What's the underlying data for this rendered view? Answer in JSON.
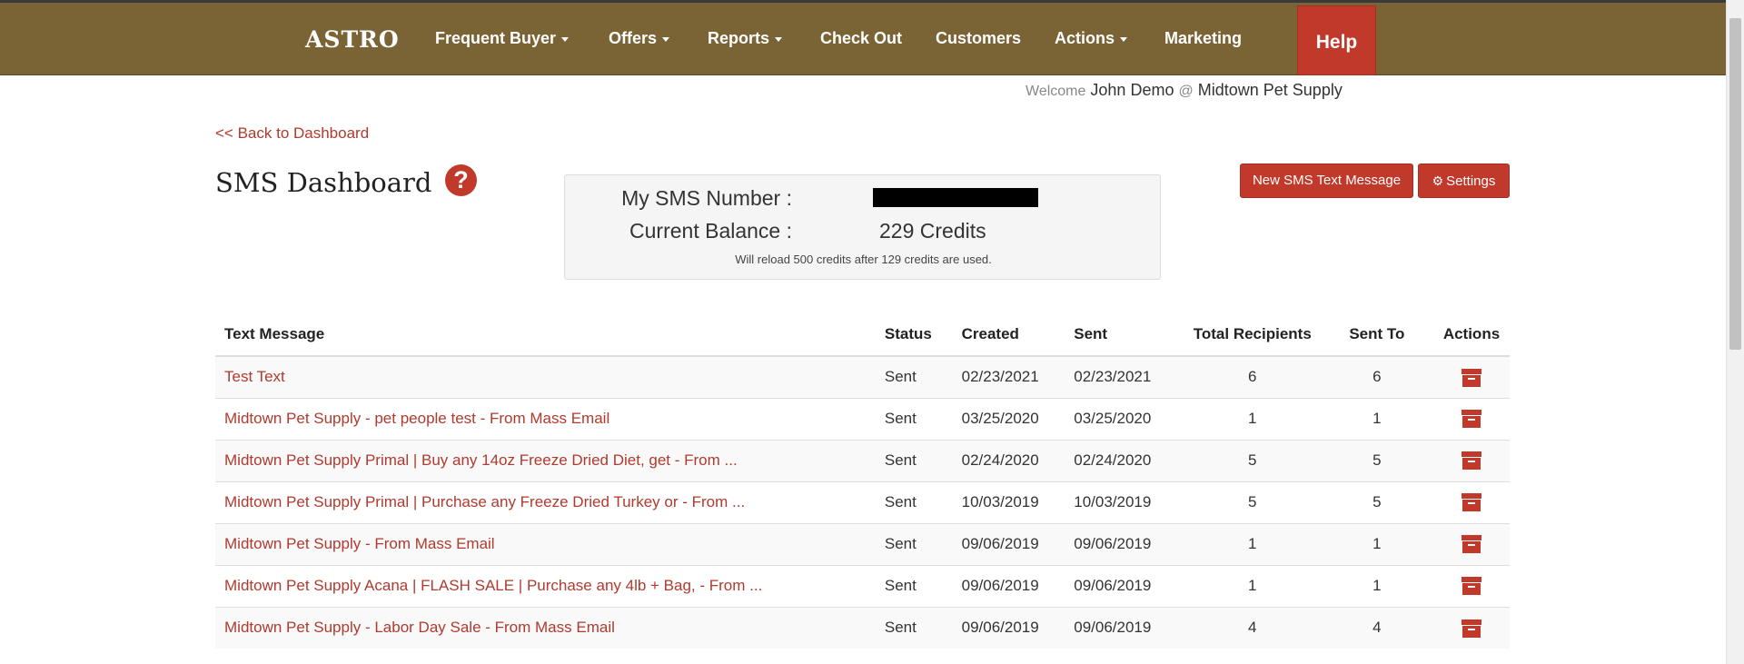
{
  "nav": {
    "brand": "ASTRO",
    "items": [
      {
        "label": "Frequent Buyer",
        "dropdown": true
      },
      {
        "label": "Offers",
        "dropdown": true
      },
      {
        "label": "Reports",
        "dropdown": true
      },
      {
        "label": "Check Out",
        "dropdown": false
      },
      {
        "label": "Customers",
        "dropdown": false
      },
      {
        "label": "Actions",
        "dropdown": true
      },
      {
        "label": "Marketing",
        "dropdown": false
      }
    ],
    "help": "Help",
    "colors": {
      "bar": "#7a6334",
      "accent": "#c0392b"
    }
  },
  "welcome": {
    "prefix": "Welcome",
    "user": "John Demo",
    "at": "@",
    "store": "Midtown Pet Supply"
  },
  "back_link": "<< Back to Dashboard",
  "page_title": "SMS Dashboard",
  "help_icon": "question-circle-icon",
  "balance": {
    "number_label": "My SMS Number :",
    "balance_label": "Current Balance :",
    "balance_value": "229 Credits",
    "note": "Will reload 500 credits after 129 credits are used."
  },
  "buttons": {
    "new_sms": "New SMS Text Message",
    "settings": "Settings",
    "settings_icon": "gear-icon"
  },
  "table": {
    "headers": [
      "Text Message",
      "Status",
      "Created",
      "Sent",
      "Total Recipients",
      "Sent To",
      "Actions"
    ],
    "rows": [
      {
        "message": "Test Text",
        "status": "Sent",
        "created": "02/23/2021",
        "sent": "02/23/2021",
        "total": "6",
        "sent_to": "6"
      },
      {
        "message": "Midtown Pet Supply - pet people test - From Mass Email",
        "status": "Sent",
        "created": "03/25/2020",
        "sent": "03/25/2020",
        "total": "1",
        "sent_to": "1"
      },
      {
        "message": "Midtown Pet Supply Primal | Buy any 14oz Freeze Dried Diet, get - From ...",
        "status": "Sent",
        "created": "02/24/2020",
        "sent": "02/24/2020",
        "total": "5",
        "sent_to": "5"
      },
      {
        "message": "Midtown Pet Supply Primal | Purchase any Freeze Dried Turkey or - From ...",
        "status": "Sent",
        "created": "10/03/2019",
        "sent": "10/03/2019",
        "total": "5",
        "sent_to": "5"
      },
      {
        "message": "Midtown Pet Supply - From Mass Email",
        "status": "Sent",
        "created": "09/06/2019",
        "sent": "09/06/2019",
        "total": "1",
        "sent_to": "1"
      },
      {
        "message": "Midtown Pet Supply Acana | FLASH SALE | Purchase any 4lb + Bag, - From ...",
        "status": "Sent",
        "created": "09/06/2019",
        "sent": "09/06/2019",
        "total": "1",
        "sent_to": "1"
      },
      {
        "message": "Midtown Pet Supply - Labor Day Sale - From Mass Email",
        "status": "Sent",
        "created": "09/06/2019",
        "sent": "09/06/2019",
        "total": "4",
        "sent_to": "4"
      }
    ],
    "action_icon": "archive-icon"
  }
}
